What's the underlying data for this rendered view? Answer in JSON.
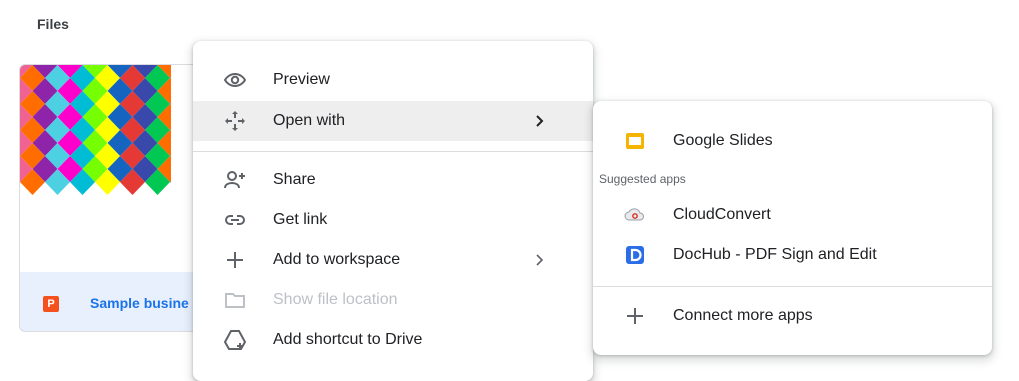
{
  "section": {
    "title": "Files"
  },
  "file_card": {
    "name": "Sample busine",
    "type_badge": "P"
  },
  "context_menu": {
    "items": [
      {
        "label": "Preview",
        "icon": "eye-icon"
      },
      {
        "label": "Open with",
        "icon": "move-arrows-icon",
        "submenu": true
      },
      {
        "label": "Share",
        "icon": "person-add-icon"
      },
      {
        "label": "Get link",
        "icon": "link-icon"
      },
      {
        "label": "Add to workspace",
        "icon": "plus-icon",
        "submenu": true
      },
      {
        "label": "Show file location",
        "icon": "folder-icon",
        "disabled": true
      },
      {
        "label": "Add shortcut to Drive",
        "icon": "drive-shortcut-icon"
      }
    ]
  },
  "open_with_menu": {
    "default_app": {
      "label": "Google Slides",
      "icon": "google-slides-icon"
    },
    "suggested_heading": "Suggested apps",
    "suggested": [
      {
        "label": "CloudConvert",
        "icon": "cloudconvert-icon"
      },
      {
        "label": "DocHub - PDF Sign and Edit",
        "icon": "dochub-icon"
      }
    ],
    "connect": {
      "label": "Connect more apps",
      "icon": "plus-icon"
    }
  },
  "colors": {
    "accent": "#1a73e8",
    "slides_yellow": "#f4b400",
    "presentation_orange": "#f4511e",
    "dochub_blue": "#2b6de6"
  }
}
